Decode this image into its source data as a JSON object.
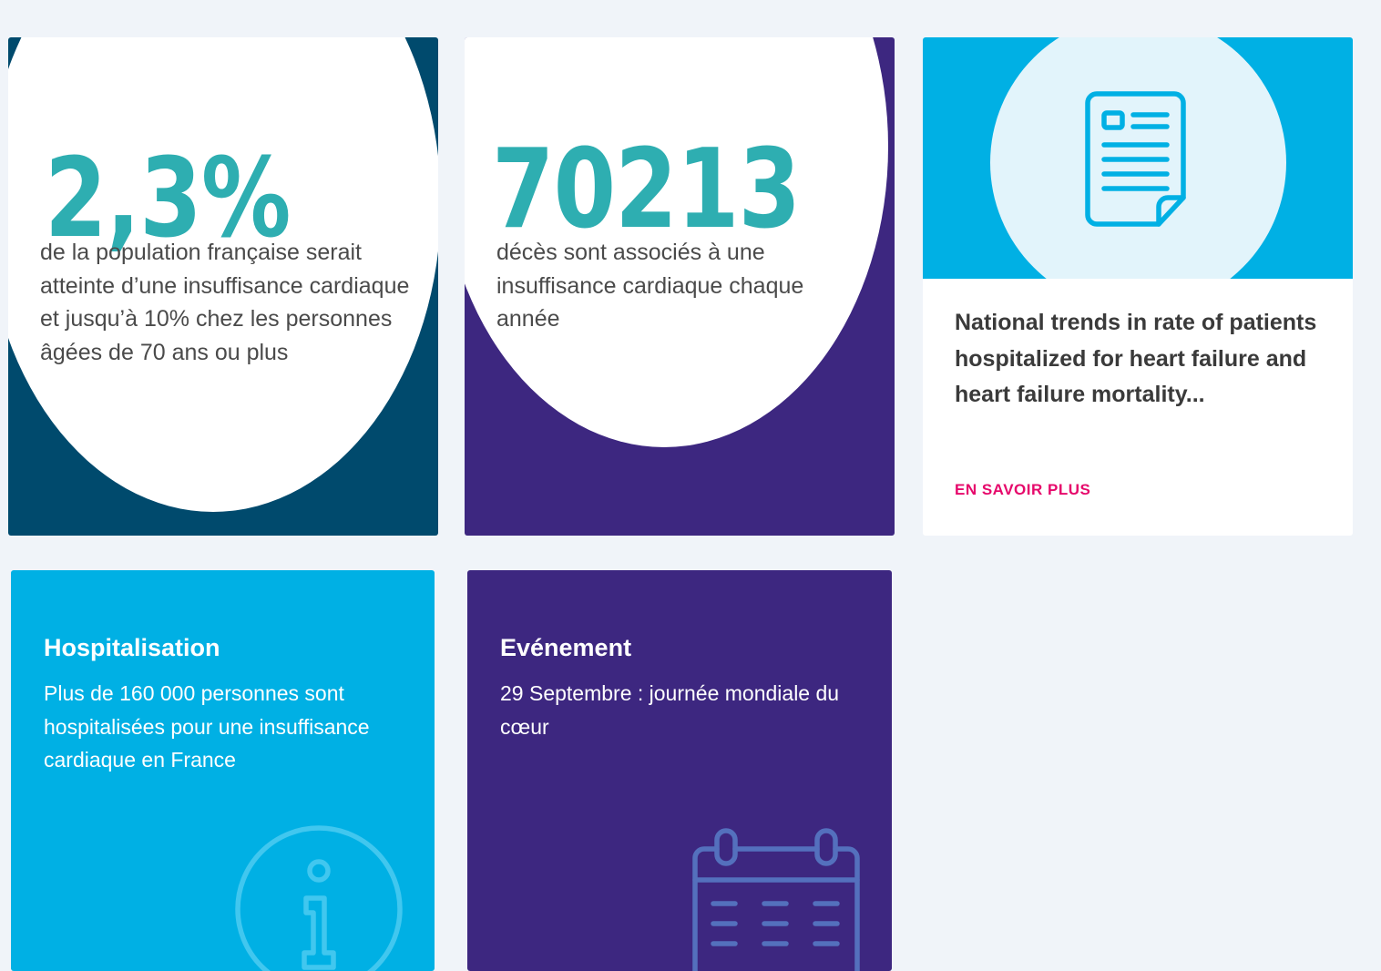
{
  "stats": [
    {
      "value": "2,3%",
      "description": "de la population française serait atteinte d’une insuffisance cardiaque et jusqu’à 10% chez les personnes âgées de 70 ans ou plus"
    },
    {
      "value": "70213",
      "description": "décès sont associés à une insuffisance cardiaque chaque année"
    }
  ],
  "article": {
    "icon": "document-icon",
    "title": "National trends in rate of patients hospitalized for heart failure and heart failure mortality...",
    "link_label": "EN SAVOIR PLUS"
  },
  "info_cards": [
    {
      "heading": "Hospitalisation",
      "body": "Plus de 160 000 personnes sont hospitalisées pour une insuffisance cardiaque en France",
      "icon": "info-icon"
    },
    {
      "heading": "Evénement",
      "body": "29 Septembre : journée mondiale du cœur",
      "icon": "calendar-icon"
    }
  ],
  "colors": {
    "page_background": "#f0f4f9",
    "navy": "#004a6d",
    "purple": "#3d2780",
    "cyan": "#00b0e4",
    "teal_number": "#2eaeb1",
    "link_pink": "#e6086b"
  }
}
